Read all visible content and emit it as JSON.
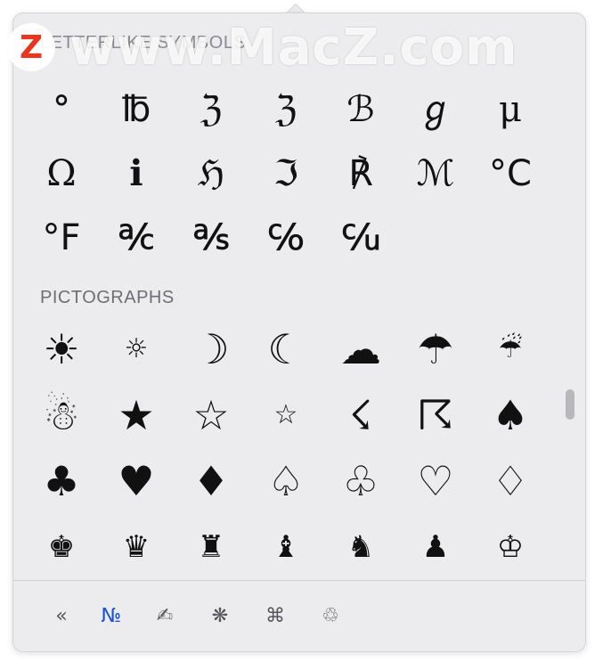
{
  "sections": {
    "letterlike": {
      "title": "LETTERLIKE SYMBOLS",
      "glyphs": [
        "°",
        "℔",
        "ℨ",
        "ℨ",
        "ℬ",
        "ℊ",
        "μ",
        "Ω",
        "ℹ",
        "ℌ",
        "ℑ",
        "℟",
        "ℳ",
        "°C",
        "°F",
        "℀",
        "℁",
        "℅",
        "℆"
      ]
    },
    "pictographs": {
      "title": "PICTOGRAPHS",
      "glyphs": [
        "☀",
        "☼",
        "☽",
        "☾",
        "☁",
        "☂",
        "☔",
        "☃",
        "★",
        "☆",
        "☆",
        "☇",
        "☈",
        "♠",
        "♣",
        "♥",
        "♦",
        "♤",
        "♧",
        "♡",
        "♢",
        "♚",
        "♛",
        "♜",
        "♝",
        "♞",
        "♟",
        "♔"
      ]
    }
  },
  "footer": {
    "buttons": [
      {
        "glyph": "«",
        "name": "collapse-icon"
      },
      {
        "glyph": "№",
        "name": "letterlike-category-icon"
      },
      {
        "glyph": "✍",
        "name": "pictographs-category-icon"
      },
      {
        "glyph": "❋",
        "name": "bullets-stars-category-icon"
      },
      {
        "glyph": "⌘",
        "name": "technical-symbols-category-icon"
      },
      {
        "glyph": "♲",
        "name": "sign-standard-symbols-category-icon"
      }
    ],
    "active_index": 1
  },
  "watermark": {
    "logo_letter": "Z",
    "text": "www.MacZ.com"
  },
  "colors": {
    "panel_bg": "#ececee",
    "glyph": "#111111",
    "section_label": "#6e6e73",
    "active_tab": "#1a4fd6",
    "watermark_logo": "#e8361e"
  }
}
